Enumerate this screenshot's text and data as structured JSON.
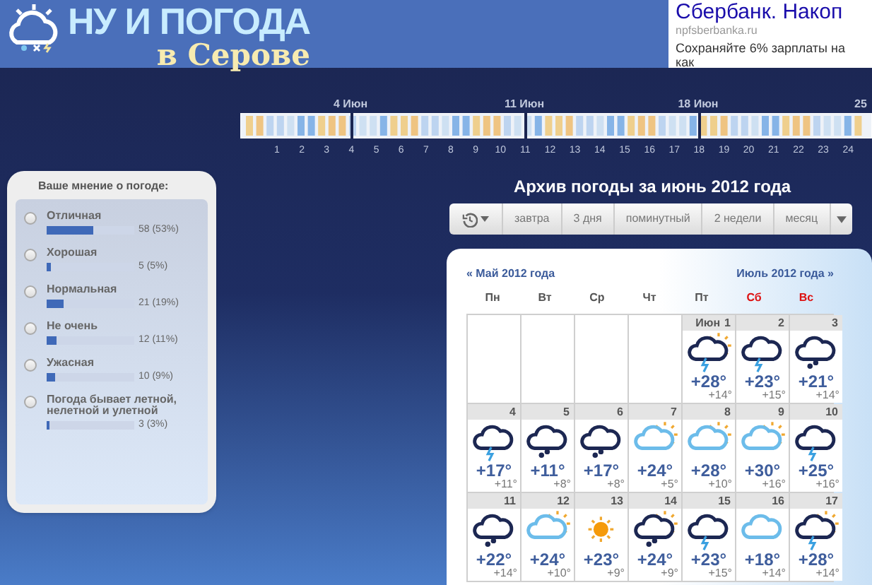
{
  "header": {
    "logo_title": "НУ И ПОГОДА",
    "logo_subtitle": "в Серове"
  },
  "ad": {
    "title": "Сбербанк. Накоп",
    "domain": "npfsberbanka.ru",
    "text": "Сохраняйте 6% зарплаты на как"
  },
  "timeline": {
    "week_labels": [
      "4 Июн",
      "11 Июн",
      "18 Июн",
      "25"
    ],
    "days": [
      "1",
      "2",
      "3",
      "4",
      "5",
      "6",
      "7",
      "8",
      "9",
      "10",
      "11",
      "12",
      "13",
      "14",
      "15",
      "16",
      "17",
      "18",
      "19",
      "20",
      "21",
      "22",
      "23",
      "24"
    ]
  },
  "poll": {
    "title": "Ваше мнение о погоде:",
    "options": [
      {
        "label": "Отличная",
        "result": "58 (53%)",
        "level": 0.53,
        "selected": false
      },
      {
        "label": "Хорошая",
        "result": "5 (5%)",
        "level": 0.05,
        "selected": false
      },
      {
        "label": "Нормальная",
        "result": "21 (19%)",
        "level": 0.19,
        "selected": false
      },
      {
        "label": "Не очень",
        "result": "12 (11%)",
        "level": 0.11,
        "selected": false
      },
      {
        "label": "Ужасная",
        "result": "10 (9%)",
        "level": 0.09,
        "selected": false
      },
      {
        "label": "Погода бывает летной, нелетной и улетной",
        "result": "3 (3%)",
        "level": 0.03,
        "selected": false
      }
    ]
  },
  "archive": {
    "title": "Архив погоды за июнь 2012 года",
    "toolbar": [
      "завтра",
      "3 дня",
      "поминутный",
      "2 недели",
      "месяц"
    ],
    "prev_link": "« Май 2012 года",
    "next_link": "Июль 2012 года »",
    "weekdays": [
      {
        "label": "Пн",
        "weekend": false
      },
      {
        "label": "Вт",
        "weekend": false
      },
      {
        "label": "Ср",
        "weekend": false
      },
      {
        "label": "Чт",
        "weekend": false
      },
      {
        "label": "Пт",
        "weekend": false
      },
      {
        "label": "Сб",
        "weekend": true
      },
      {
        "label": "Вс",
        "weekend": true
      }
    ],
    "weeks": [
      [
        {
          "kind": "blank"
        },
        {
          "kind": "blank"
        },
        {
          "kind": "blank"
        },
        {
          "kind": "blank"
        },
        {
          "month": "Июн",
          "day": "1",
          "kind": "thunder-sun",
          "high": "+28°",
          "low": "+14°"
        },
        {
          "day": "2",
          "kind": "thunder",
          "high": "+23°",
          "low": "+15°"
        },
        {
          "day": "3",
          "kind": "rain",
          "high": "+21°",
          "low": "+14°"
        }
      ],
      [
        {
          "day": "4",
          "kind": "thunder",
          "high": "+17°",
          "low": "+11°"
        },
        {
          "day": "5",
          "kind": "rain",
          "high": "+11°",
          "low": "+8°"
        },
        {
          "day": "6",
          "kind": "rain",
          "high": "+17°",
          "low": "+8°"
        },
        {
          "day": "7",
          "kind": "partly",
          "high": "+24°",
          "low": "+5°"
        },
        {
          "day": "8",
          "kind": "partly",
          "high": "+28°",
          "low": "+10°"
        },
        {
          "day": "9",
          "kind": "partly",
          "high": "+30°",
          "low": "+16°"
        },
        {
          "day": "10",
          "kind": "thunder",
          "high": "+25°",
          "low": "+16°"
        }
      ],
      [
        {
          "day": "11",
          "kind": "rain",
          "high": "+22°",
          "low": "+14°"
        },
        {
          "day": "12",
          "kind": "partly",
          "high": "+24°",
          "low": "+10°"
        },
        {
          "day": "13",
          "kind": "sun",
          "high": "+23°",
          "low": "+9°"
        },
        {
          "day": "14",
          "kind": "rain-sun",
          "high": "+24°",
          "low": "+9°"
        },
        {
          "day": "15",
          "kind": "thunder",
          "high": "+23°",
          "low": "+15°"
        },
        {
          "day": "16",
          "kind": "cloud",
          "high": "+18°",
          "low": "+14°"
        },
        {
          "day": "17",
          "kind": "thunder-sun",
          "high": "+28°",
          "low": "+14°"
        }
      ]
    ]
  }
}
